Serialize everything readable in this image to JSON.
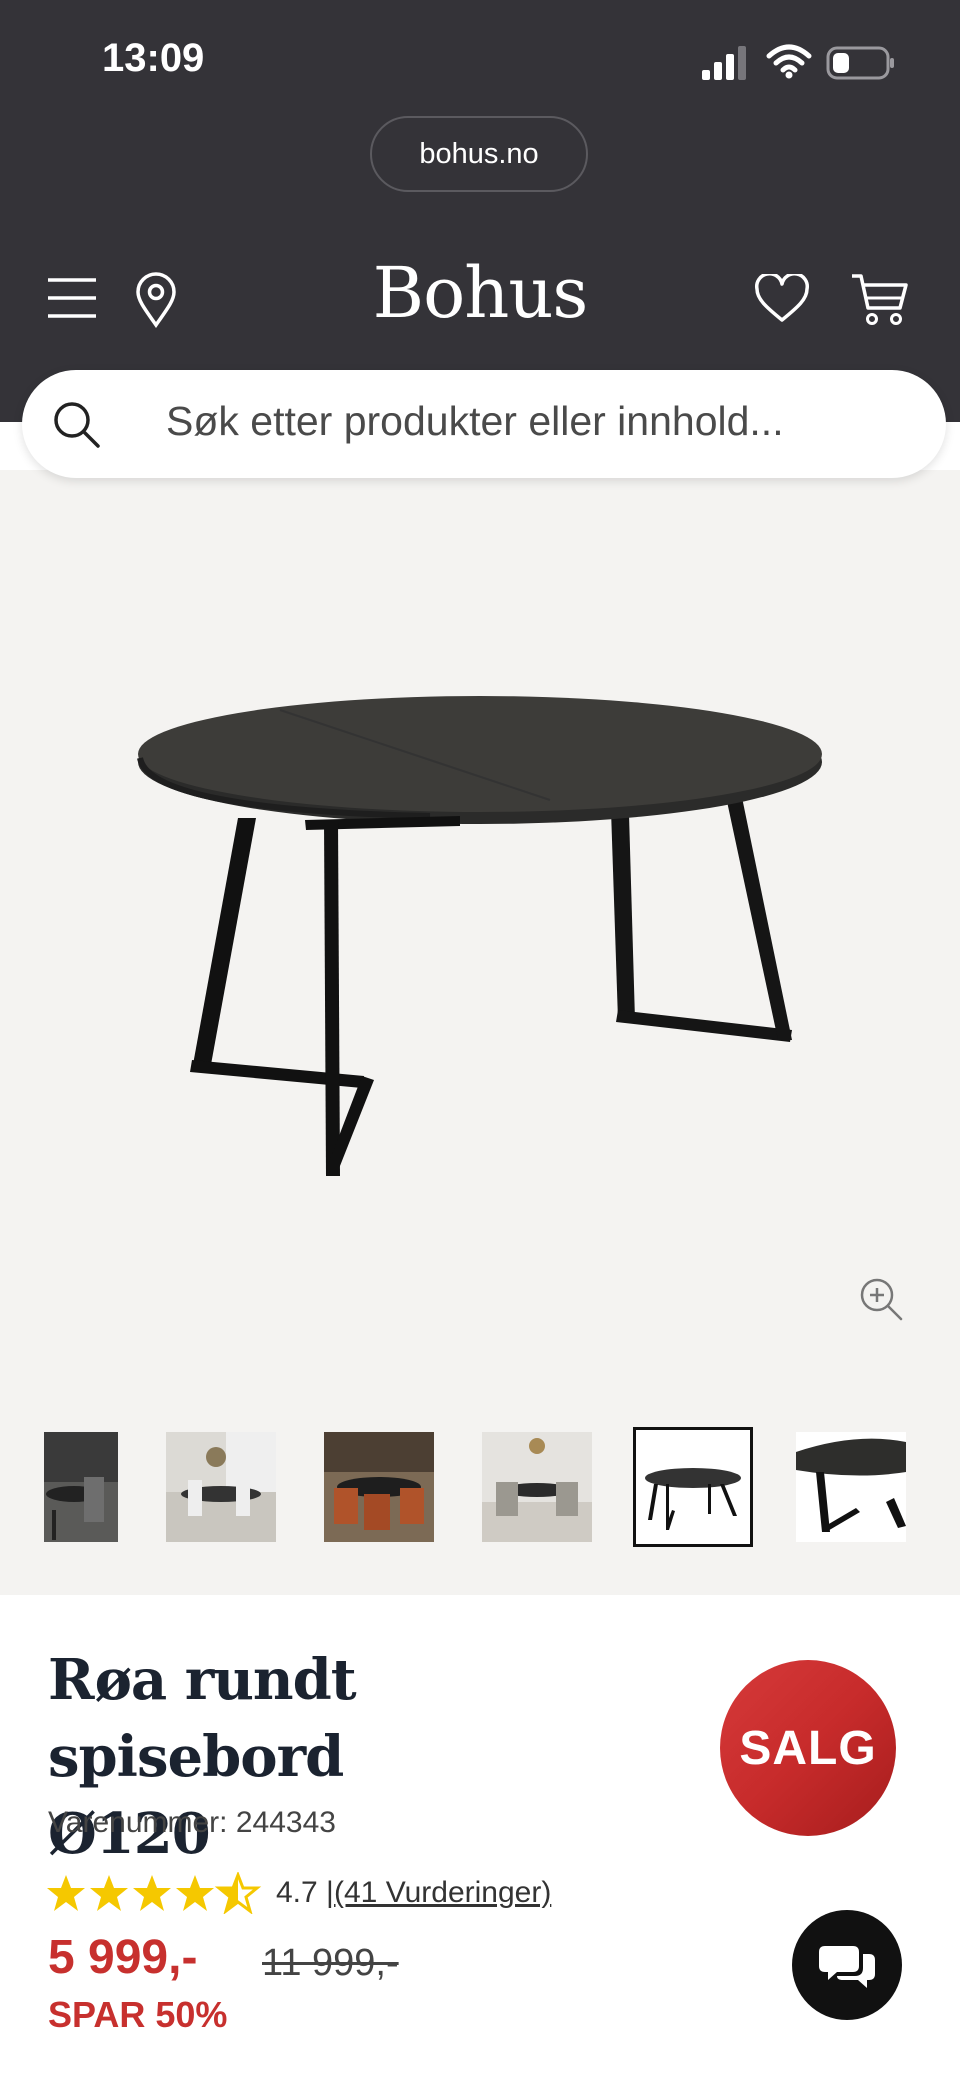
{
  "status_bar": {
    "time": "13:09"
  },
  "browser": {
    "url": "bohus.no"
  },
  "header": {
    "logo": "Bohus"
  },
  "search": {
    "placeholder": "Søk etter produkter eller innhold..."
  },
  "gallery": {
    "thumbnail_count": 6,
    "active_index": 4
  },
  "product": {
    "title_line1": "Røa rundt spisebord",
    "title_line2": "Ø120",
    "sku": "Varenummer: 244343",
    "badge": "SALG",
    "rating_text": "4.7 |",
    "reviews_link": "(41 Vurderinger)",
    "rating_value": 4.7,
    "price": "5 999,-",
    "old_price": "11 999,-",
    "savings": "SPAR 50%"
  },
  "colors": {
    "header_bg": "#343338",
    "sale_red": "#c7302e",
    "hero_bg": "#f4f3f1",
    "star": "#f5c800"
  }
}
